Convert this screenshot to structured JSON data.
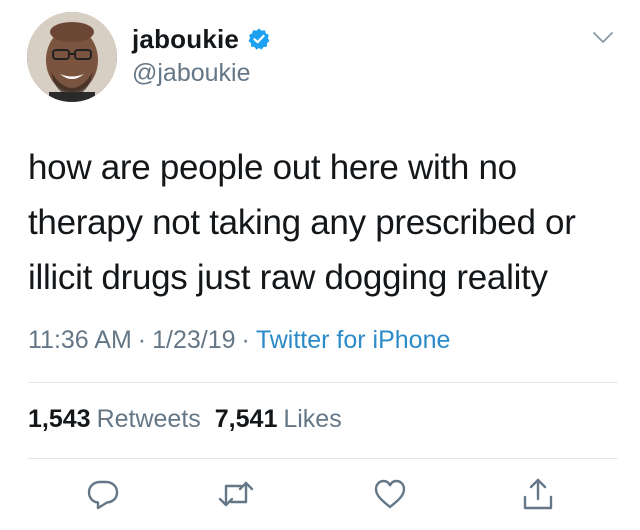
{
  "user": {
    "display_name": "jaboukie",
    "handle": "@jaboukie",
    "verified": true
  },
  "tweet": {
    "text": "how are people out here with no therapy not taking any prescribed or illicit drugs just raw dogging reality",
    "time": "11:36 AM",
    "date": "1/23/19",
    "source": "Twitter for iPhone",
    "separator": "·"
  },
  "stats": {
    "retweets_count": "1,543",
    "retweets_label": "Retweets",
    "likes_count": "7,541",
    "likes_label": "Likes"
  },
  "icons": {
    "verified": "verified-badge-icon",
    "caret": "chevron-down-icon",
    "reply": "reply-icon",
    "retweet": "retweet-icon",
    "like": "heart-icon",
    "share": "share-icon"
  },
  "colors": {
    "text": "#14171a",
    "secondary": "#657786",
    "link": "#2b8bc8",
    "verified": "#1da1f2",
    "divider": "#e1e8ed"
  }
}
